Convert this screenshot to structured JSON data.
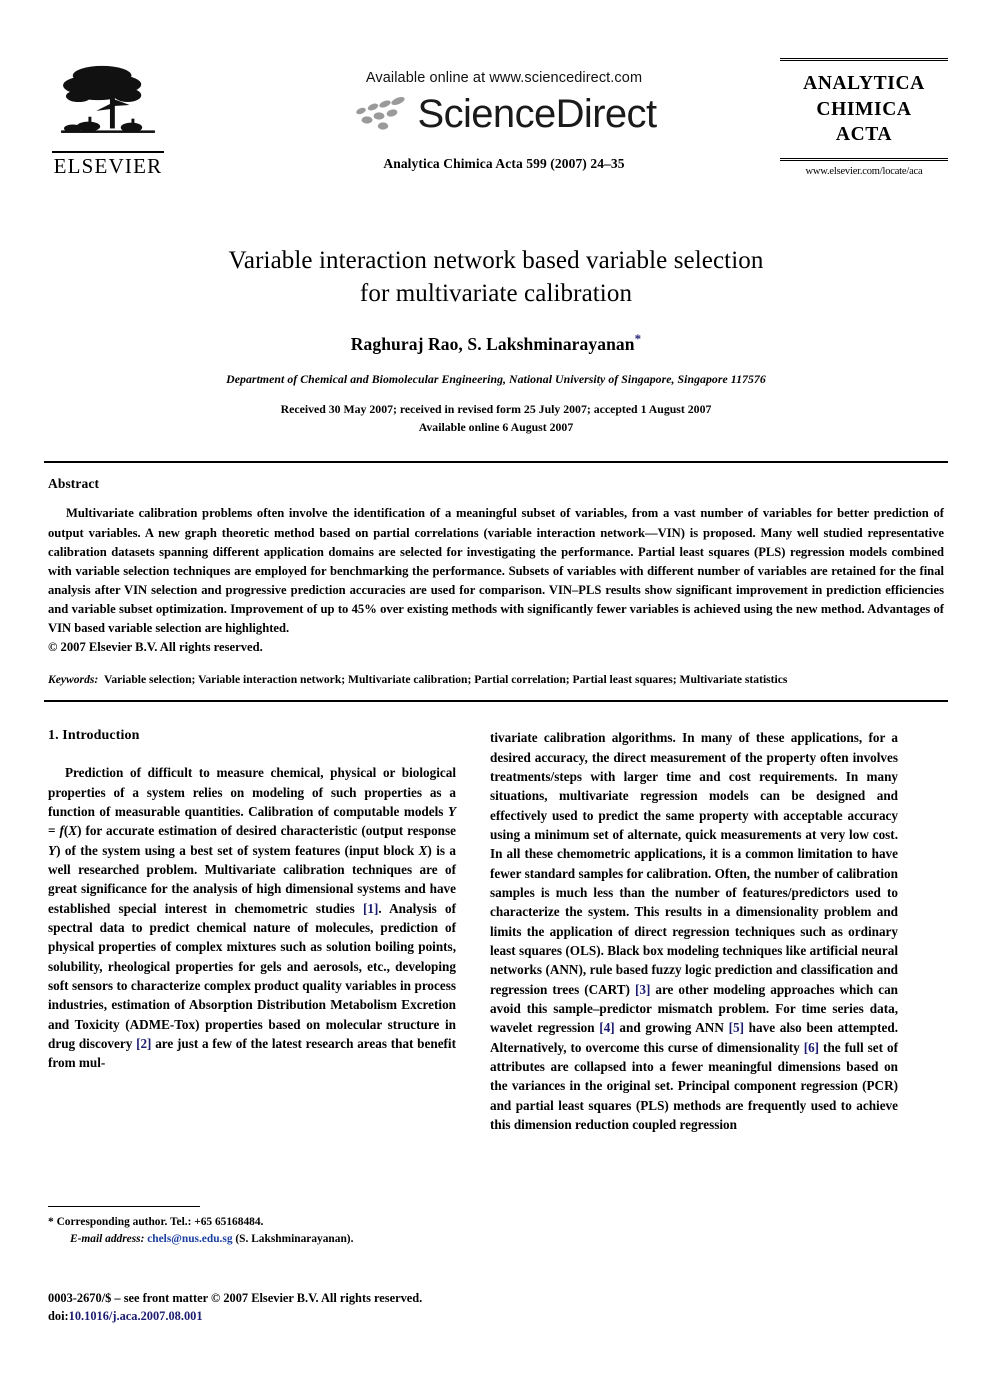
{
  "header": {
    "publisher": "ELSEVIER",
    "available_online": "Available online at www.sciencedirect.com",
    "sciencedirect_wordmark": "ScienceDirect",
    "journal_reference": "Analytica Chimica Acta 599 (2007) 24–35",
    "masthead_line1": "ANALYTICA",
    "masthead_line2": "CHIMICA",
    "masthead_line3": "ACTA",
    "masthead_url": "www.elsevier.com/locate/aca"
  },
  "article": {
    "title_line1": "Variable interaction network based variable selection",
    "title_line2": "for multivariate calibration",
    "authors": "Raghuraj Rao, S. Lakshminarayanan",
    "corresponding_marker": "*",
    "affiliation": "Department of Chemical and Biomolecular Engineering, National University of Singapore, Singapore 117576",
    "history_line1": "Received 30 May 2007; received in revised form 25 July 2007; accepted 1 August 2007",
    "history_line2": "Available online 6 August 2007"
  },
  "abstract": {
    "heading": "Abstract",
    "text": "Multivariate calibration problems often involve the identification of a meaningful subset of variables, from a vast number of variables for better prediction of output variables. A new graph theoretic method based on partial correlations (variable interaction network—VIN) is proposed. Many well studied representative calibration datasets spanning different application domains are selected for investigating the performance. Partial least squares (PLS) regression models combined with variable selection techniques are employed for benchmarking the performance. Subsets of variables with different number of variables are retained for the final analysis after VIN selection and progressive prediction accuracies are used for comparison. VIN–PLS results show significant improvement in prediction efficiencies and variable subset optimization. Improvement of up to 45% over existing methods with significantly fewer variables is achieved using the new method. Advantages of VIN based variable selection are highlighted.",
    "copyright": "© 2007 Elsevier B.V. All rights reserved.",
    "keywords_label": "Keywords:",
    "keywords_value": "Variable selection; Variable interaction network; Multivariate calibration; Partial correlation; Partial least squares; Multivariate statistics"
  },
  "body": {
    "section_heading": "1.  Introduction",
    "left_column": {
      "p1_a": "Prediction of difficult to measure chemical, physical or biological properties of a system relies on modeling of such properties as a function of measurable quantities. Calibration of computable models ",
      "p1_math1": "Y",
      "p1_b": " = ",
      "p1_math2": "f",
      "p1_c": "(",
      "p1_math3": "X",
      "p1_d": ") for accurate estimation of desired characteristic (output response ",
      "p1_math4": "Y",
      "p1_e": ") of the system using a best set of system features (input block ",
      "p1_math5": "X",
      "p1_f": ") is a well researched problem. Multivariate calibration techniques are of great significance for the analysis of high dimensional systems and have established special interest in chemometric studies ",
      "ref1": "[1]",
      "p1_g": ". Analysis of spectral data to predict chemical nature of molecules, prediction of physical properties of complex mixtures such as solution boiling points, solubility, rheological properties for gels and aerosols, etc., developing soft sensors to characterize complex product quality variables in process industries, estimation of Absorption Distribution Metabolism Excretion and Toxicity (ADME-Tox) properties based on molecular structure in drug discovery ",
      "ref2": "[2]",
      "p1_h": " are just a few of the latest research areas that benefit from mul-"
    },
    "right_column": {
      "p_a": "tivariate calibration algorithms. In many of these applications, for a desired accuracy, the direct measurement of the property often involves treatments/steps with larger time and cost requirements. In many situations, multivariate regression models can be designed and effectively used to predict the same property with acceptable accuracy using a minimum set of alternate, quick measurements at very low cost. In all these chemometric applications, it is a common limitation to have fewer standard samples for calibration. Often, the number of calibration samples is much less than the number of features/predictors used to characterize the system. This results in a dimensionality problem and limits the application of direct regression techniques such as ordinary least squares (OLS). Black box modeling techniques like artificial neural networks (ANN), rule based fuzzy logic prediction and classification and regression trees (CART) ",
      "ref3": "[3]",
      "p_b": " are other modeling approaches which can avoid this sample–predictor mismatch problem. For time series data, wavelet regression ",
      "ref4": "[4]",
      "p_c": " and growing ANN ",
      "ref5": "[5]",
      "p_d": " have also been attempted. Alternatively, to overcome this curse of dimensionality ",
      "ref6": "[6]",
      "p_e": " the full set of attributes are collapsed into a fewer meaningful dimensions based on the variances in the original set. Principal component regression (PCR) and partial least squares (PLS) methods are frequently used to achieve this dimension reduction coupled regression"
    }
  },
  "footnote": {
    "marker": "*",
    "corresponding_author": "Corresponding author. Tel.: +65 65168484.",
    "email_label": "E-mail address:",
    "email": "chels@nus.edu.sg",
    "email_owner": "(S. Lakshminarayanan)."
  },
  "imprint": {
    "front_matter": "0003-2670/$ – see front matter © 2007 Elsevier B.V. All rights reserved.",
    "doi_label": "doi:",
    "doi_value": "10.1016/j.aca.2007.08.001"
  }
}
